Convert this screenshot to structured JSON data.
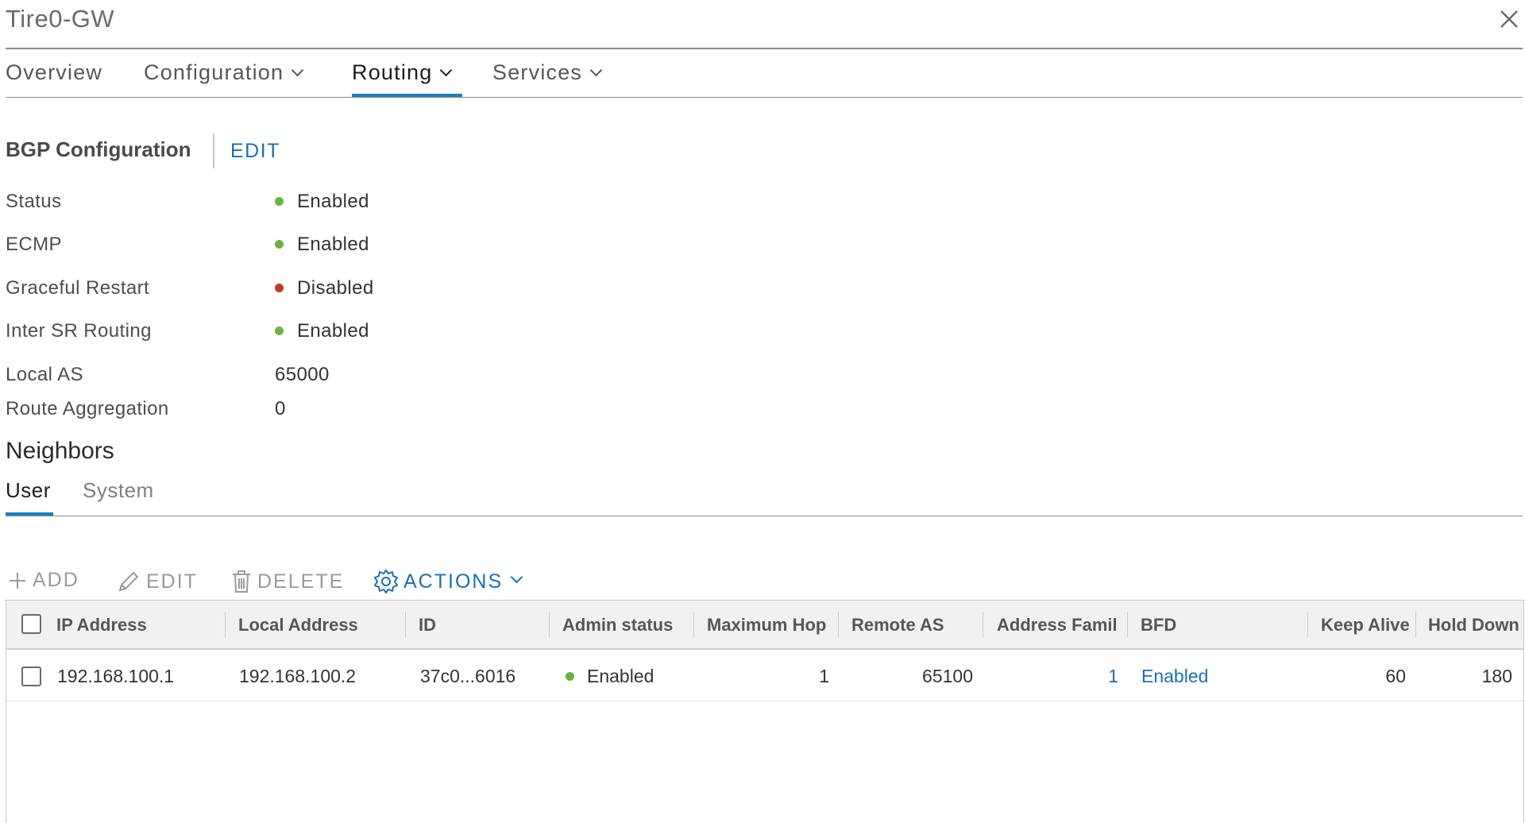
{
  "window": {
    "title": "Tire0-GW",
    "close_icon": "close-icon"
  },
  "tabs": [
    {
      "label": "Overview",
      "has_dropdown": false,
      "active": false
    },
    {
      "label": "Configuration",
      "has_dropdown": true,
      "active": false
    },
    {
      "label": "Routing",
      "has_dropdown": true,
      "active": true
    },
    {
      "label": "Services",
      "has_dropdown": true,
      "active": false
    }
  ],
  "bgp": {
    "title": "BGP Configuration",
    "edit_label": "EDIT",
    "properties": [
      {
        "label": "Status",
        "value": "Enabled",
        "status_color": "#6db33f"
      },
      {
        "label": "ECMP",
        "value": "Enabled",
        "status_color": "#6db33f"
      },
      {
        "label": "Graceful Restart",
        "value": "Disabled",
        "status_color": "#c0392b"
      },
      {
        "label": "Inter SR Routing",
        "value": "Enabled",
        "status_color": "#6db33f"
      },
      {
        "label": "Local AS",
        "value": "65000"
      },
      {
        "label": "Route Aggregation",
        "value": "0"
      }
    ]
  },
  "neighbors": {
    "title": "Neighbors",
    "subtabs": [
      {
        "label": "User",
        "active": true
      },
      {
        "label": "System",
        "active": false
      }
    ],
    "toolbar": {
      "add_label": "ADD",
      "edit_label": "EDIT",
      "delete_label": "DELETE",
      "actions_label": "ACTIONS"
    },
    "columns": [
      "IP Address",
      "Local Address",
      "ID",
      "Admin status",
      "Maximum Hop",
      "Remote AS",
      "Address Famil",
      "BFD",
      "Keep Alive",
      "Hold Down"
    ],
    "rows": [
      {
        "ip_address": "192.168.100.1",
        "local_address": "192.168.100.2",
        "id": "37c0...6016",
        "admin_status": "Enabled",
        "maximum_hop": "1",
        "remote_as": "65100",
        "address_family": "1",
        "bfd": "Enabled",
        "keep_alive": "60",
        "hold_down": "180"
      }
    ]
  },
  "colors": {
    "accent": "#1a7ec2",
    "link": "#1a6fb5",
    "enabled": "#6db33f",
    "disabled": "#c0392b"
  }
}
